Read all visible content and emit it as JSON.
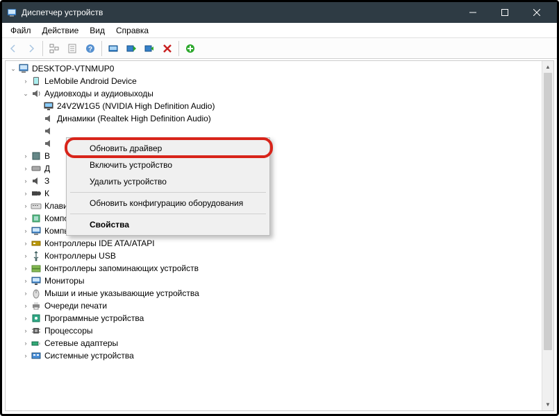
{
  "window": {
    "title": "Диспетчер устройств"
  },
  "menu": {
    "file": "Файл",
    "action": "Действие",
    "view": "Вид",
    "help": "Справка"
  },
  "tree": {
    "root": "DESKTOP-VTNMUP0",
    "items": [
      "LeMobile Android Device",
      "Аудиовходы и аудиовыходы",
      "24V2W1G5 (NVIDIA High Definition Audio)",
      "Динамики (Realtek High Definition Audio)",
      "",
      "",
      "В",
      "Д",
      "З",
      "К",
      "Клавиатуры",
      "Компоненты программного обеспечения",
      "Компьютер",
      "Контроллеры IDE ATA/ATAPI",
      "Контроллеры USB",
      "Контроллеры запоминающих устройств",
      "Мониторы",
      "Мыши и иные указывающие устройства",
      "Очереди печати",
      "Программные устройства",
      "Процессоры",
      "Сетевые адаптеры",
      "Системные устройства"
    ]
  },
  "context_menu": {
    "update_driver": "Обновить драйвер",
    "enable_device": "Включить устройство",
    "uninstall_device": "Удалить устройство",
    "scan_hardware": "Обновить конфигурацию оборудования",
    "properties": "Свойства"
  }
}
